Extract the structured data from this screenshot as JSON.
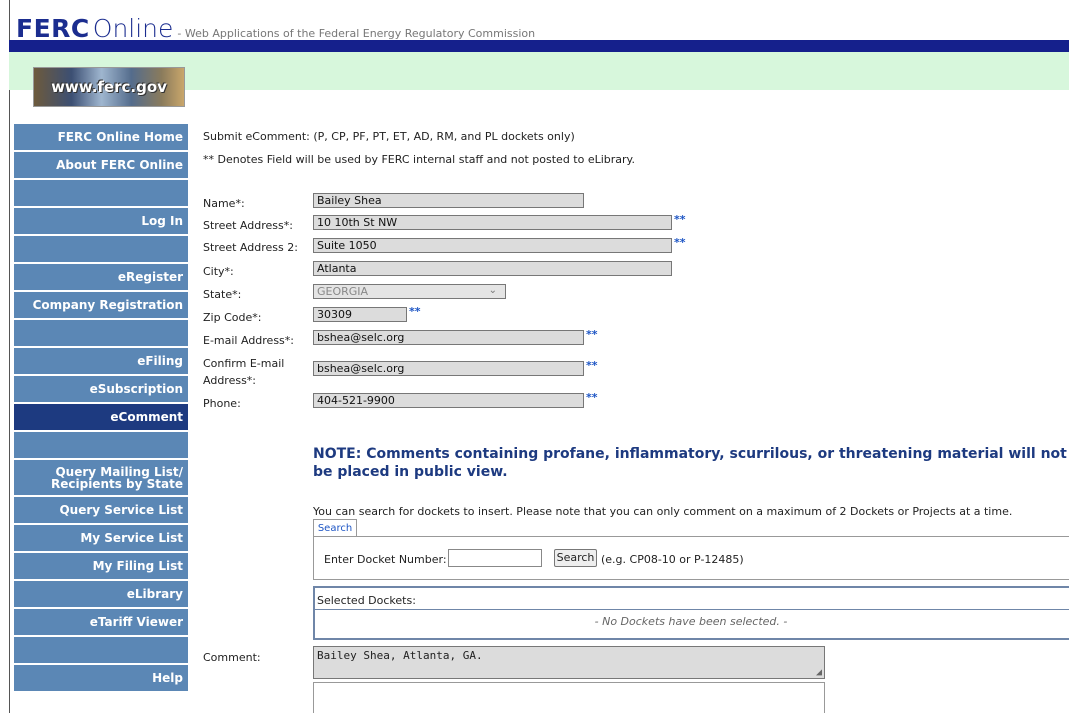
{
  "header": {
    "brand_ferc": "FERC",
    "brand_online": "Online",
    "tagline": "- Web Applications of the Federal Energy Regulatory Commission",
    "logo_text": "www.ferc.gov"
  },
  "sidebar": {
    "items": [
      {
        "label": "FERC Online Home",
        "active": false
      },
      {
        "label": "About FERC Online",
        "active": false
      },
      {
        "label": "",
        "blank": true
      },
      {
        "label": "Log In",
        "active": false
      },
      {
        "label": "",
        "blank": true
      },
      {
        "label": "eRegister",
        "active": false
      },
      {
        "label": "Company Registration",
        "active": false
      },
      {
        "label": "",
        "blank": true
      },
      {
        "label": "eFiling",
        "active": false
      },
      {
        "label": "eSubscription",
        "active": false
      },
      {
        "label": "eComment",
        "active": true
      },
      {
        "label": "",
        "blank": true
      },
      {
        "label": "Query Mailing List/ Recipients by State",
        "active": false,
        "tall": true
      },
      {
        "label": "Query Service List",
        "active": false
      },
      {
        "label": "My Service List",
        "active": false
      },
      {
        "label": "My Filing List",
        "active": false
      },
      {
        "label": "eLibrary",
        "active": false
      },
      {
        "label": "eTariff Viewer",
        "active": false
      },
      {
        "label": "",
        "blank": true
      },
      {
        "label": "Help",
        "active": false
      }
    ]
  },
  "intro": {
    "line1": "Submit eComment: (P, CP, PF, PT, ET, AD, RM, and PL dockets only)",
    "line2": "** Denotes Field will be used by FERC internal staff and not posted to eLibrary."
  },
  "form": {
    "name_label": "Name*:",
    "name_value": "Bailey Shea",
    "street_label": "Street Address*:",
    "street_value": "10 10th St NW",
    "street2_label": "Street Address 2:",
    "street2_value": "Suite 1050",
    "city_label": "City*:",
    "city_value": "Atlanta",
    "state_label": "State*:",
    "state_value": "GEORGIA",
    "zip_label": "Zip Code*:",
    "zip_value": "30309",
    "email_label": "E-mail Address*:",
    "email_value": "bshea@selc.org",
    "confirm_label": "Confirm E-mail Address*:",
    "confirm_value": "bshea@selc.org",
    "phone_label": "Phone:",
    "phone_value": "404-521-9900",
    "stars": "**"
  },
  "note": "NOTE: Comments containing profane, inflammatory, scurrilous, or threatening material will not be placed in public view.",
  "docket": {
    "info": "You can search for dockets to insert. Please note that you can only comment on a maximum of 2 Dockets or Projects at a time.",
    "tab_label": "Search",
    "enter_label": "Enter Docket Number:",
    "input_value": "",
    "search_button": "Search",
    "example": "(e.g. CP08-10 or P-12485)",
    "selected_header": "Selected Dockets:",
    "none_selected": "- No Dockets have been selected. -"
  },
  "comment": {
    "label": "Comment:",
    "value": "Bailey Shea, Atlanta, GA."
  }
}
